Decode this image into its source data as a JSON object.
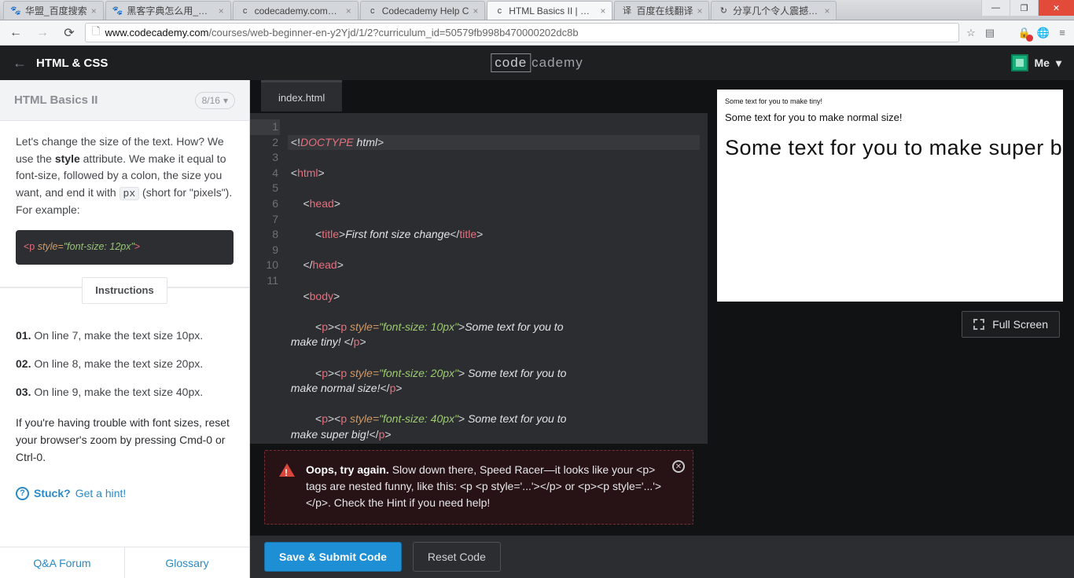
{
  "tabs": [
    {
      "label": "华盟_百度搜索",
      "fav": "🐾"
    },
    {
      "label": "黑客字典怎么用_百度",
      "fav": "🐾"
    },
    {
      "label": "codecademy.com_百",
      "fav": "c"
    },
    {
      "label": "Codecademy Help C",
      "fav": "c"
    },
    {
      "label": "HTML Basics II | Cod",
      "fav": "c",
      "active": true
    },
    {
      "label": "百度在线翻译",
      "fav": "译"
    },
    {
      "label": "分享几个令人震撼的J",
      "fav": "↻"
    }
  ],
  "url": {
    "host": "www.codecademy.com",
    "path": "/courses/web-beginner-en-y2Yjd/1/2?curriculum_id=50579fb998b470000202dc8b"
  },
  "winbtns": {
    "min": "—",
    "max": "❐",
    "close": "✕"
  },
  "app": {
    "back": "←",
    "course": "HTML & CSS",
    "logo_box": "code",
    "logo_rest": "cademy",
    "user": "Me",
    "caret": "▾"
  },
  "sidebar": {
    "title": "HTML Basics II",
    "progress": "8/16",
    "caret": "▾",
    "para1_a": "Let's change the size of the text. How? We use the ",
    "para1_b": "style",
    "para1_c": " attribute. We make it equal to font-size, followed by a colon, the size you want, and end it with ",
    "para1_d": "px",
    "para1_e": " (short for \"pixels\"). For example:",
    "code_example": "<p style=\"font-size: 12px\">",
    "instructions_label": "Instructions",
    "steps": [
      {
        "num": "01.",
        "text": " On line 7, make the text size 10px."
      },
      {
        "num": "02.",
        "text": " On line 8, make the text size 20px."
      },
      {
        "num": "03.",
        "text": " On line 9, make the text size 40px."
      }
    ],
    "trouble": "If you're having trouble with font sizes, reset your browser's zoom by pressing Cmd-0 or Ctrl-0.",
    "hint_icon": "?",
    "hint_strong": "Stuck?",
    "hint_rest": " Get a hint!",
    "footer": [
      "Q&A Forum",
      "Glossary"
    ]
  },
  "editor": {
    "filename": "index.html",
    "gutter": [
      "1",
      "2",
      "3",
      "4",
      "5",
      "6",
      "7",
      "8",
      "9",
      "10",
      "11"
    ],
    "active_line": 0
  },
  "preview": {
    "tiny": "Some text for you to make tiny!",
    "normal": "Some text for you to make normal size!",
    "big": "Some text for you to make super big!",
    "fullscreen": "Full Screen"
  },
  "error": {
    "strong": "Oops, try again.",
    "rest": " Slow down there, Speed Racer—it looks like your <p> tags are nested funny, like this: <p <p style='...'></p> or <p><p style='...'></p>. Check the Hint if you need help!"
  },
  "buttons": {
    "submit": "Save & Submit Code",
    "reset": "Reset Code"
  }
}
